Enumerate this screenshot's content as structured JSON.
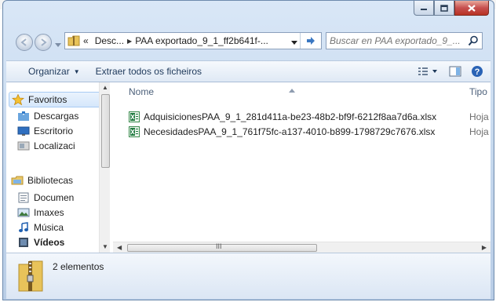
{
  "window": {
    "buttons": {
      "minimize": "minimize",
      "maximize": "maximize",
      "close": "close"
    }
  },
  "address_bar": {
    "overflow": "«",
    "crumbs": [
      "Desc...",
      "PAA exportado_9_1_ff2b641f-..."
    ],
    "separator": "▶",
    "dropdown_icon": "chevron-down-icon",
    "refresh_icon": "refresh-icon"
  },
  "search": {
    "placeholder": "Buscar en PAA exportado_9_..."
  },
  "toolbar": {
    "organize_label": "Organizar",
    "extract_label": "Extraer todos os ficheiros"
  },
  "sidebar": {
    "items": [
      {
        "label": "Favoritos",
        "icon": "star-icon"
      },
      {
        "label": "Descargas",
        "icon": "downloads-folder-icon"
      },
      {
        "label": "Escritorio",
        "icon": "desktop-icon"
      },
      {
        "label": "Localizaci",
        "icon": "recent-places-icon"
      },
      {
        "label": "Bibliotecas",
        "icon": "libraries-icon"
      },
      {
        "label": "Documen",
        "icon": "documents-icon"
      },
      {
        "label": "Imaxes",
        "icon": "pictures-icon"
      },
      {
        "label": "Música",
        "icon": "music-icon"
      },
      {
        "label": "Vídeos",
        "icon": "videos-icon"
      }
    ]
  },
  "file_list": {
    "columns": [
      "Nome",
      "Tipo"
    ],
    "rows": [
      {
        "name": "AdquisicionesPAA_9_1_281d411a-be23-48b2-bf9f-6212f8aa7d6a.xlsx",
        "type": "Hoja d"
      },
      {
        "name": "NecesidadesPAA_9_1_761f75fc-a137-4010-b899-1798729c7676.xlsx",
        "type": "Hoja d"
      }
    ],
    "scroll_grip": "III"
  },
  "details_pane": {
    "count": "2 elementos"
  },
  "colors": {
    "chrome": "#c8d9ee",
    "selection": "#d5e7fb",
    "excel_green": "#1f7a3f",
    "close_red": "#c75050"
  }
}
